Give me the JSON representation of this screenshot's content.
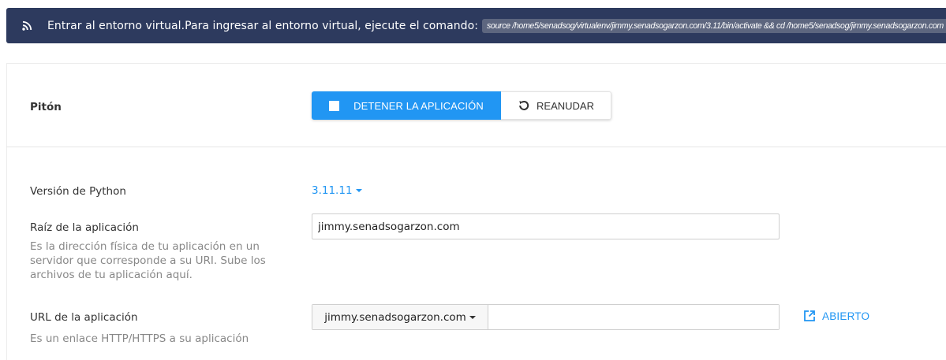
{
  "banner": {
    "icon": "rss-icon",
    "message": "Entrar al entorno virtual.Para ingresar al entorno virtual, ejecute el comando:",
    "command": "source /home5/senadsog/virtualenv/jimmy.senadsogarzon.com/3.11/bin/activate && cd /home5/senadsog/jimmy.senadsogarzon.com"
  },
  "app": {
    "title": "Pitón",
    "stop_button": "DETENER LA APLICACIÓN",
    "restart_button": "REANUDAR"
  },
  "python_version": {
    "label": "Versión de Python",
    "value": "3.11.11"
  },
  "app_root": {
    "label": "Raíz de la aplicación",
    "hint": "Es la dirección física de tu aplicación en un servidor que corresponde a su URI. Sube los archivos de tu aplicación aquí.",
    "value": "jimmy.senadsogarzon.com"
  },
  "app_url": {
    "label": "URL de la aplicación",
    "hint": "Es un enlace HTTP/HTTPS a su aplicación",
    "domain": "jimmy.senadsogarzon.com",
    "path": "",
    "open_link": "ABIERTO"
  },
  "colors": {
    "banner_bg": "#2d3a5e",
    "accent": "#2196f3",
    "command_bg": "#5d667f"
  }
}
